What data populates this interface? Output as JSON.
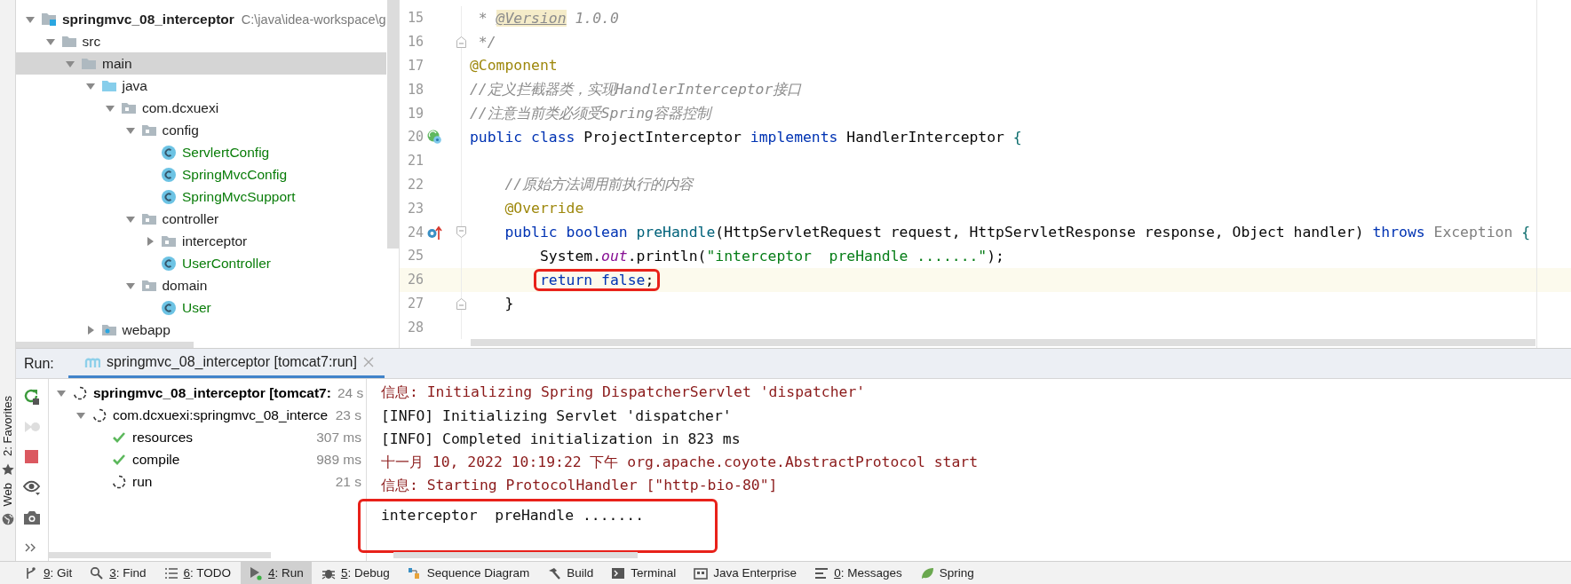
{
  "tool_strip": [
    {
      "label": "2: Favorites",
      "kind": "favorites"
    },
    {
      "label": "Web",
      "kind": "web"
    }
  ],
  "project_tree": {
    "items": [
      {
        "label": "springmvc_08_interceptor",
        "path": "C:\\java\\idea-workspace\\g",
        "kind": "module",
        "expanded": true,
        "selected": false,
        "children": [
          {
            "label": "src",
            "kind": "folder",
            "expanded": true,
            "selected": false,
            "children": [
              {
                "label": "main",
                "kind": "folder",
                "expanded": true,
                "selected": true,
                "children": [
                  {
                    "label": "java",
                    "kind": "source",
                    "expanded": true,
                    "selected": false,
                    "children": [
                      {
                        "label": "com.dcxuexi",
                        "kind": "package",
                        "expanded": true,
                        "selected": false,
                        "children": [
                          {
                            "label": "config",
                            "kind": "package",
                            "expanded": true,
                            "selected": false,
                            "children": [
                              {
                                "label": "ServlertConfig",
                                "kind": "class",
                                "selected": false
                              },
                              {
                                "label": "SpringMvcConfig",
                                "kind": "class",
                                "selected": false
                              },
                              {
                                "label": "SpringMvcSupport",
                                "kind": "class",
                                "selected": false
                              }
                            ]
                          },
                          {
                            "label": "controller",
                            "kind": "package",
                            "expanded": true,
                            "selected": false,
                            "children": [
                              {
                                "label": "interceptor",
                                "kind": "package",
                                "expanded": false,
                                "selected": false
                              },
                              {
                                "label": "UserController",
                                "kind": "class",
                                "selected": false
                              }
                            ]
                          },
                          {
                            "label": "domain",
                            "kind": "package",
                            "expanded": true,
                            "selected": false,
                            "children": [
                              {
                                "label": "User",
                                "kind": "class",
                                "selected": false
                              }
                            ]
                          }
                        ]
                      }
                    ]
                  },
                  {
                    "label": "webapp",
                    "kind": "web",
                    "expanded": false,
                    "selected": false
                  }
                ]
              }
            ]
          }
        ]
      }
    ]
  },
  "editor": {
    "lines": [
      {
        "number": "15",
        "current": false,
        "tokens": [
          {
            "text": " * ",
            "kind": "comment"
          },
          {
            "text": "@Version",
            "kind": "doctag"
          },
          {
            "text": " 1.0.0",
            "kind": "comment"
          }
        ]
      },
      {
        "number": "16",
        "current": false,
        "fold": {
          "kind": "end"
        },
        "tokens": [
          {
            "text": " */",
            "kind": "comment"
          }
        ]
      },
      {
        "number": "17",
        "current": false,
        "tokens": [
          {
            "text": "@Component",
            "kind": "annotation"
          }
        ]
      },
      {
        "number": "18",
        "current": false,
        "tokens": [
          {
            "text": "//定义拦截器类，实现HandlerInterceptor接口",
            "kind": "comment"
          }
        ]
      },
      {
        "number": "19",
        "current": false,
        "tokens": [
          {
            "text": "//注意当前类必须受Spring容器控制",
            "kind": "comment"
          }
        ]
      },
      {
        "number": "20",
        "current": false,
        "marker": {
          "kind": "implemented"
        },
        "tokens": [
          {
            "text": "public class",
            "kind": "keyword"
          },
          {
            "text": " ProjectInterceptor ",
            "kind": "plain"
          },
          {
            "text": "implements",
            "kind": "keyword"
          },
          {
            "text": " HandlerInterceptor ",
            "kind": "plain"
          },
          {
            "text": "{",
            "kind": "brace"
          }
        ]
      },
      {
        "number": "21",
        "current": false
      },
      {
        "number": "22",
        "current": false,
        "tokens": [
          {
            "text": "    //原始方法调用前执行的内容",
            "kind": "comment"
          }
        ]
      },
      {
        "number": "23",
        "current": false,
        "tokens": [
          {
            "text": "    @Override",
            "kind": "annotation"
          }
        ]
      },
      {
        "number": "24",
        "current": false,
        "marker": {
          "kind": "overrides"
        },
        "fold": {
          "kind": "start"
        },
        "tokens": [
          {
            "text": "    public boolean",
            "kind": "keyword"
          },
          {
            "text": " preHandle",
            "kind": "method"
          },
          {
            "text": "(HttpServletRequest request, HttpServletResponse response, Object handler) ",
            "kind": "plain"
          },
          {
            "text": "throws",
            "kind": "keyword"
          },
          {
            "text": " Exception ",
            "kind": "muted"
          },
          {
            "text": "{",
            "kind": "brace"
          }
        ]
      },
      {
        "number": "25",
        "current": false,
        "tokens": [
          {
            "text": "        System.",
            "kind": "plain"
          },
          {
            "text": "out",
            "kind": "field"
          },
          {
            "text": ".println(",
            "kind": "plain"
          },
          {
            "text": "\"interceptor  preHandle .......\"",
            "kind": "string"
          },
          {
            "text": ");",
            "kind": "plain"
          }
        ]
      },
      {
        "number": "26",
        "current": true,
        "boxed": true,
        "tokens": [
          {
            "text": "return false",
            "kind": "keyword"
          },
          {
            "text": ";",
            "kind": "plain"
          }
        ]
      },
      {
        "number": "27",
        "current": false,
        "fold": {
          "kind": "end"
        },
        "tokens": [
          {
            "text": "    }",
            "kind": "plain"
          }
        ]
      },
      {
        "number": "28",
        "current": false
      }
    ]
  },
  "run_panel": {
    "label": "Run:",
    "tab": {
      "label": "springmvc_08_interceptor [tomcat7:run]",
      "selected": true
    },
    "tools": [
      {
        "kind": "rerun",
        "disabled": false
      },
      {
        "kind": "rerun-failed",
        "disabled": true
      },
      {
        "kind": "stop",
        "disabled": false
      },
      {
        "kind": "view",
        "disabled": false
      },
      {
        "kind": "screenshot",
        "disabled": false
      },
      {
        "kind": "more",
        "disabled": false
      }
    ],
    "tree": [
      {
        "label": "springmvc_08_interceptor [tomcat7:",
        "time": "24 s",
        "done": false,
        "expanded": true,
        "children": [
          {
            "label": "com.dcxuexi:springmvc_08_interce",
            "time": "23 s",
            "done": false,
            "expanded": true,
            "children": [
              {
                "label": "resources",
                "time": "307 ms",
                "done": true
              },
              {
                "label": "compile",
                "time": "989 ms",
                "done": true
              },
              {
                "label": "run",
                "time": "21 s",
                "done": false
              }
            ]
          }
        ]
      }
    ],
    "console": [
      {
        "text": "信息: Initializing Spring DispatcherServlet 'dispatcher'",
        "kind": "stderr",
        "boxed": false
      },
      {
        "text": "[INFO] Initializing Servlet 'dispatcher'",
        "kind": "stdout",
        "boxed": false
      },
      {
        "text": "[INFO] Completed initialization in 823 ms",
        "kind": "stdout",
        "boxed": false
      },
      {
        "text": "十一月 10, 2022 10:19:22 下午 org.apache.coyote.AbstractProtocol start",
        "kind": "stderr",
        "boxed": false
      },
      {
        "text": "信息: Starting ProtocolHandler [\"http-bio-80\"]",
        "kind": "stderr",
        "boxed": false
      },
      {
        "text": "interceptor  preHandle .......",
        "kind": "stdout",
        "boxed": true
      }
    ]
  },
  "bottom_bar": [
    {
      "label": "9: Git",
      "kind": "git",
      "mnemonic": true,
      "selected": false
    },
    {
      "label": "3: Find",
      "kind": "find",
      "mnemonic": true,
      "selected": false
    },
    {
      "label": "6: TODO",
      "kind": "todo",
      "mnemonic": true,
      "selected": false
    },
    {
      "label": "4: Run",
      "kind": "run",
      "mnemonic": true,
      "selected": true
    },
    {
      "label": "5: Debug",
      "kind": "debug",
      "mnemonic": true,
      "selected": false
    },
    {
      "label": "Sequence Diagram",
      "kind": "diagram",
      "mnemonic": false,
      "selected": false
    },
    {
      "label": "Build",
      "kind": "build",
      "mnemonic": false,
      "selected": false
    },
    {
      "label": "Terminal",
      "kind": "terminal",
      "mnemonic": false,
      "selected": false
    },
    {
      "label": "Java Enterprise",
      "kind": "enterprise",
      "mnemonic": false,
      "selected": false
    },
    {
      "label": "0: Messages",
      "kind": "messages",
      "mnemonic": true,
      "selected": false
    },
    {
      "label": "Spring",
      "kind": "spring",
      "mnemonic": false,
      "selected": false
    }
  ]
}
